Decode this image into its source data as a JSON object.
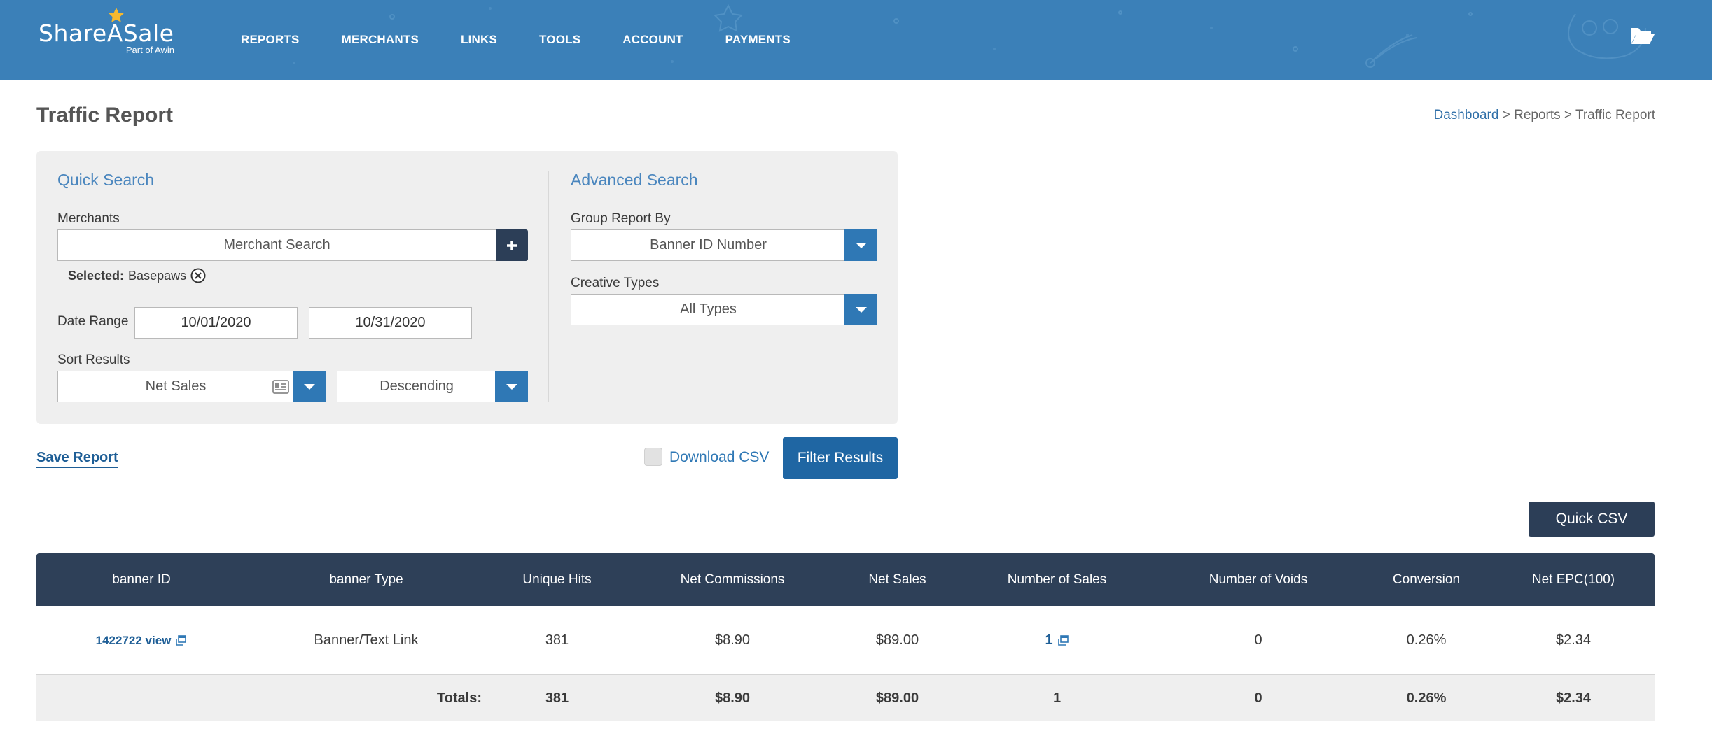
{
  "brand": {
    "name": "ShareASale",
    "tagline": "Part of Awin",
    "accent": "#3b80b8",
    "dark": "#2c3e57",
    "link": "#2f78b5"
  },
  "nav": {
    "items": [
      "REPORTS",
      "MERCHANTS",
      "LINKS",
      "TOOLS",
      "ACCOUNT",
      "PAYMENTS"
    ],
    "folder_icon": "folder-open-icon"
  },
  "page": {
    "title": "Traffic Report"
  },
  "breadcrumb": {
    "dashboard": "Dashboard",
    "sep1": " > ",
    "reports": "Reports",
    "sep2": " > ",
    "current": "Traffic Report"
  },
  "quick_search": {
    "title": "Quick Search",
    "merchants_label": "Merchants",
    "merchant_placeholder": "Merchant Search",
    "selected_label": "Selected:",
    "selected_value": "Basepaws",
    "date_range_label": "Date Range",
    "date_from": "10/01/2020",
    "date_to": "10/31/2020",
    "sort_label": "Sort Results",
    "sort_field": "Net Sales",
    "sort_order": "Descending"
  },
  "advanced_search": {
    "title": "Advanced Search",
    "group_label": "Group Report By",
    "group_value": "Banner ID Number",
    "creative_label": "Creative Types",
    "creative_value": "All Types"
  },
  "actions": {
    "save_report": "Save Report",
    "download_csv": "Download CSV",
    "filter_results": "Filter Results",
    "quick_csv": "Quick CSV"
  },
  "table": {
    "headers": [
      "banner ID",
      "banner Type",
      "Unique Hits",
      "Net Commissions",
      "Net Sales",
      "Number of Sales",
      "Number of Voids",
      "Conversion",
      "Net EPC(100)"
    ],
    "rows": [
      {
        "banner_id": "1422722 view",
        "banner_type": "Banner/Text Link",
        "unique_hits": "381",
        "net_commissions": "$8.90",
        "net_sales": "$89.00",
        "num_sales": "1",
        "num_voids": "0",
        "conversion": "0.26%",
        "net_epc": "$2.34"
      }
    ],
    "totals": {
      "label": "Totals:",
      "unique_hits": "381",
      "net_commissions": "$8.90",
      "net_sales": "$89.00",
      "num_sales": "1",
      "num_voids": "0",
      "conversion": "0.26%",
      "net_epc": "$2.34"
    }
  }
}
